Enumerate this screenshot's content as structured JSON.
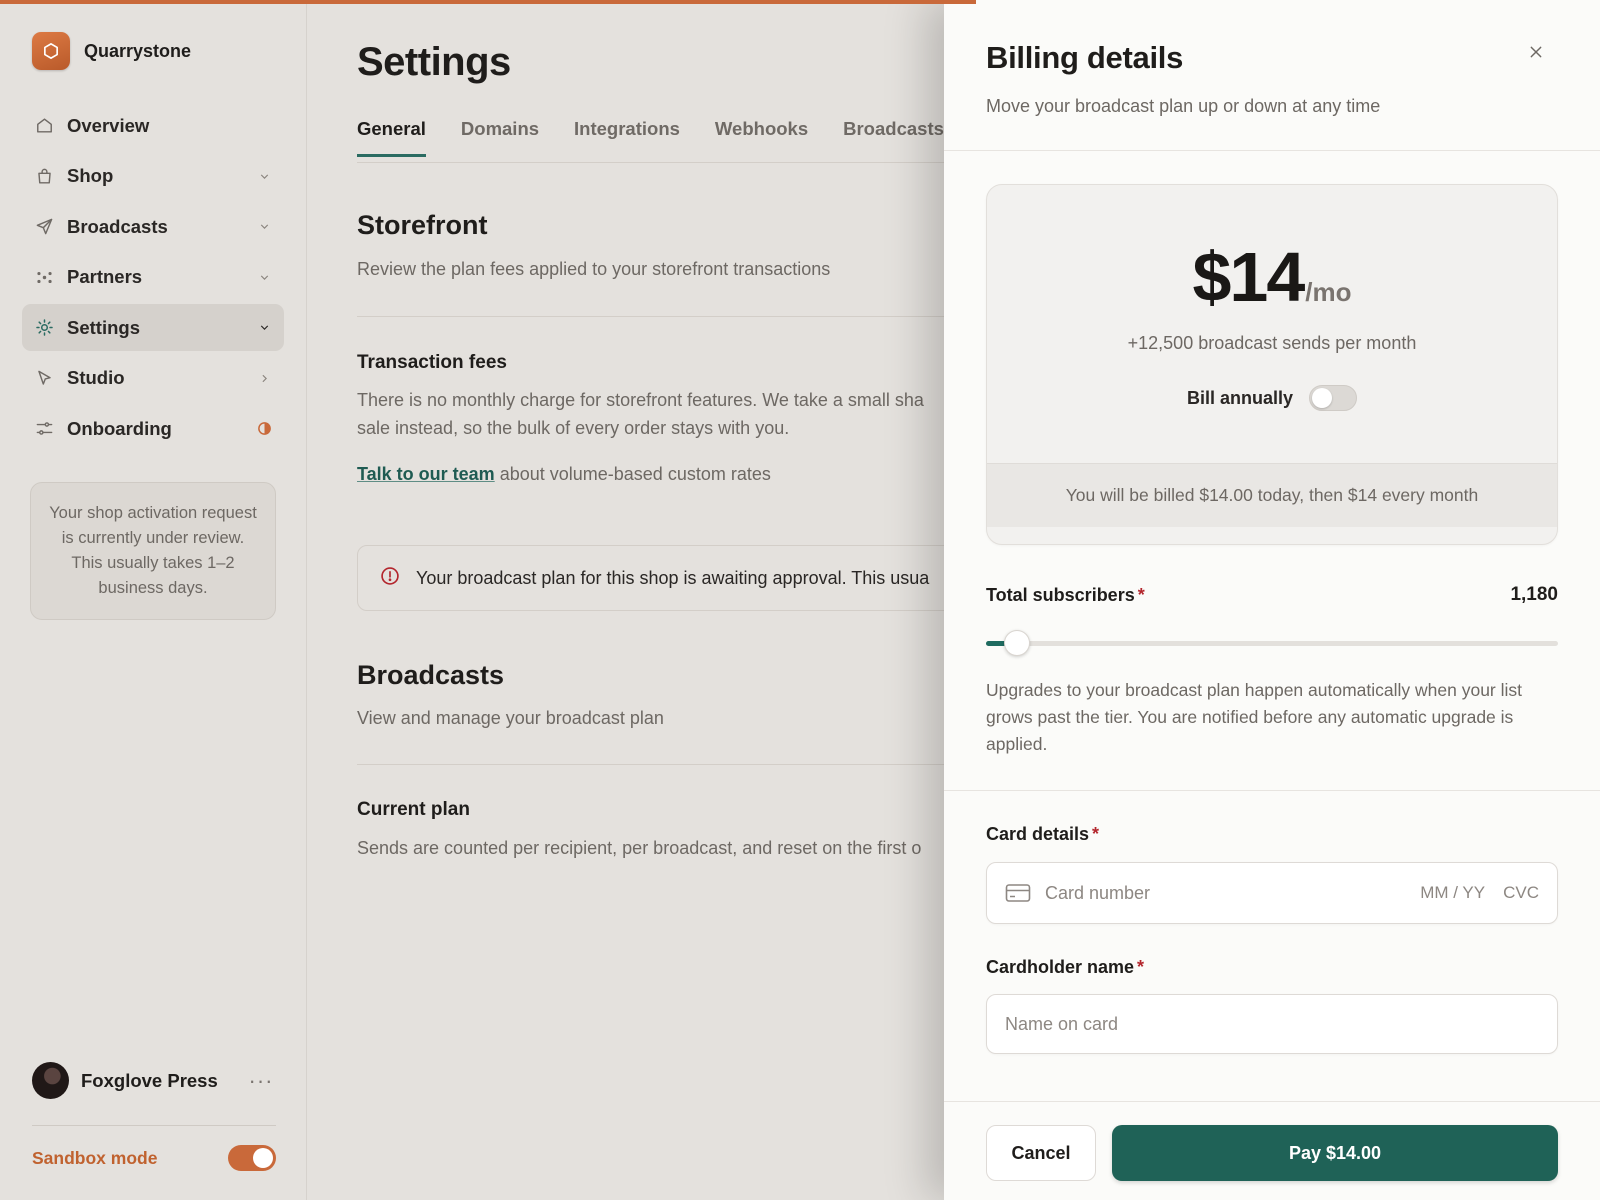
{
  "colors": {
    "accent": "#c9693a",
    "primary_button": "#1f6257",
    "link": "#1f5b52",
    "required": "#b3262d",
    "alert_icon": "#b3262d"
  },
  "sidebar": {
    "brand": {
      "name": "Quarrystone",
      "icon": "hexagon-logo-icon"
    },
    "items": [
      {
        "label": "Overview",
        "icon": "home-icon",
        "trailing": "none"
      },
      {
        "label": "Shop",
        "icon": "shopping-bag-icon",
        "trailing": "chevron-down"
      },
      {
        "label": "Broadcasts",
        "icon": "send-icon",
        "trailing": "chevron-down"
      },
      {
        "label": "Partners",
        "icon": "partners-icon",
        "trailing": "chevron-down"
      },
      {
        "label": "Settings",
        "icon": "gear-icon",
        "trailing": "chevron-down",
        "active": true
      },
      {
        "label": "Studio",
        "icon": "cursor-icon",
        "trailing": "chevron-right"
      },
      {
        "label": "Onboarding",
        "icon": "sliders-icon",
        "trailing": "progress-ring"
      }
    ],
    "activation_notice": "Your shop activation request is currently under review. This usually takes 1–2 business days.",
    "user": {
      "name": "Foxglove Press",
      "more": "···"
    },
    "sandbox": {
      "label": "Sandbox mode",
      "enabled": true
    }
  },
  "main": {
    "title": "Settings",
    "tabs": [
      "General",
      "Domains",
      "Integrations",
      "Webhooks",
      "Broadcasts"
    ],
    "active_tab": "General",
    "storefront": {
      "title": "Storefront",
      "subtitle": "Review the plan fees applied to your storefront transactions",
      "fees_title": "Transaction fees",
      "fees_text_1": "There is no monthly charge for storefront features. We take a small sha",
      "fees_text_2": "sale instead, so the bulk of every order stays with you.",
      "team_link": "Talk to our team",
      "team_suffix": " about volume-based custom rates"
    },
    "alert": "Your broadcast plan for this shop is awaiting approval. This usua",
    "broadcasts": {
      "title": "Broadcasts",
      "subtitle": "View and manage your broadcast plan",
      "plan_title": "Current plan",
      "plan_text": "Sends are counted per recipient, per broadcast, and reset on the first o"
    }
  },
  "drawer": {
    "title": "Billing details",
    "subtitle": "Move your broadcast plan up or down at any time",
    "price": "$14",
    "price_suffix": "/mo",
    "sends": "+12,500 broadcast sends per month",
    "bill_annually_label": "Bill annually",
    "bill_annually": false,
    "billing_note": "You will be billed $14.00 today, then $14 every month",
    "subscribers_label": "Total subscribers",
    "subscribers_value": "1,180",
    "subscribers_slider_fraction": 0.04,
    "help_text": "Upgrades to your broadcast plan happen automatically when your list grows past the tier. You are notified before any automatic upgrade is applied.",
    "card_label": "Card details",
    "card_placeholder": "Card number",
    "card_expiry": "MM / YY",
    "card_cvc": "CVC",
    "cardholder_label": "Cardholder name",
    "cardholder_placeholder": "Name on card",
    "required_mark": "*",
    "cancel": "Cancel",
    "pay": "Pay $14.00"
  }
}
